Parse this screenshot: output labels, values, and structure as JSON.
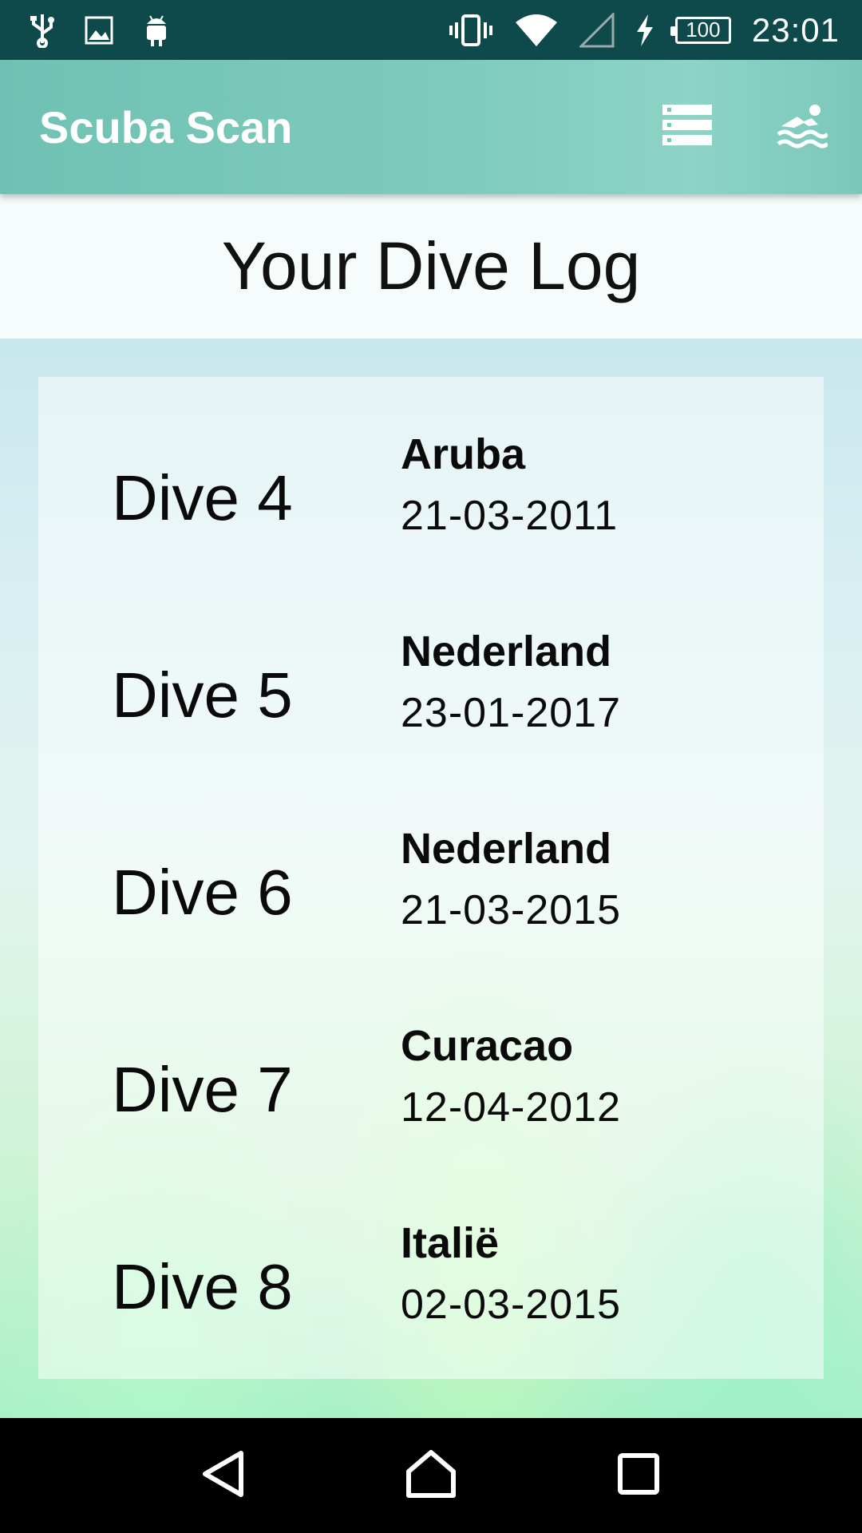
{
  "status_bar": {
    "time": "23:01",
    "battery_level": "100",
    "left_icons": [
      "usb-icon",
      "image-icon",
      "android-icon"
    ],
    "right_icons": [
      "vibrate-icon",
      "wifi-icon",
      "signal-icon",
      "charging-icon",
      "battery-icon"
    ]
  },
  "app_bar": {
    "title": "Scuba Scan",
    "actions": [
      {
        "name": "list-icon"
      },
      {
        "name": "swimmer-icon"
      }
    ]
  },
  "page": {
    "title": "Your Dive Log"
  },
  "dives": [
    {
      "name": "Dive 4",
      "place": "Aruba",
      "date": "21-03-2011"
    },
    {
      "name": "Dive 5",
      "place": "Nederland",
      "date": "23-01-2017"
    },
    {
      "name": "Dive 6",
      "place": "Nederland",
      "date": "21-03-2015"
    },
    {
      "name": "Dive 7",
      "place": "Curacao",
      "date": "12-04-2012"
    },
    {
      "name": "Dive 8",
      "place": "Italië",
      "date": "02-03-2015"
    }
  ],
  "nav_bar": {
    "buttons": [
      "back-icon",
      "home-icon",
      "recents-icon"
    ]
  },
  "colors": {
    "status_bar": "#0e4a4c",
    "app_bar": "#7bc8ba",
    "text": "#0a0a0a"
  }
}
